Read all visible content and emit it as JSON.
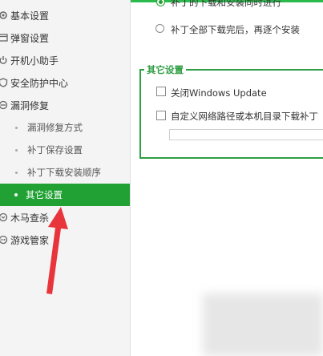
{
  "sidebar": {
    "items": [
      {
        "label": "基本设置",
        "icon": "gear-icon"
      },
      {
        "label": "弹窗设置",
        "icon": "popup-icon"
      },
      {
        "label": "开机小助手",
        "icon": "power-icon"
      },
      {
        "label": "安全防护中心",
        "icon": "shield-icon"
      },
      {
        "label": "漏洞修复",
        "icon": "patch-icon"
      },
      {
        "label": "木马查杀",
        "icon": "trojan-icon"
      },
      {
        "label": "游戏管家",
        "icon": "game-icon"
      }
    ],
    "sub_items": [
      {
        "label": "漏洞修复方式",
        "active": false
      },
      {
        "label": "补丁保存设置",
        "active": false
      },
      {
        "label": "补丁下载安装顺序",
        "active": false
      },
      {
        "label": "其它设置",
        "active": true
      }
    ]
  },
  "install_order": {
    "options": [
      {
        "label": "补丁的下载和安装同时进行",
        "selected": true
      },
      {
        "label": "补丁全部下载完后，再逐个安装",
        "selected": false
      }
    ]
  },
  "other_settings": {
    "legend": "其它设置",
    "disable_windows_update": {
      "label": "关闭Windows Update",
      "checked": false
    },
    "custom_path": {
      "label": "自定义网络路径或本机目录下载补丁",
      "checked": false,
      "value": ""
    }
  },
  "colors": {
    "accent": "#21a134",
    "arrow": "#e8353b"
  }
}
